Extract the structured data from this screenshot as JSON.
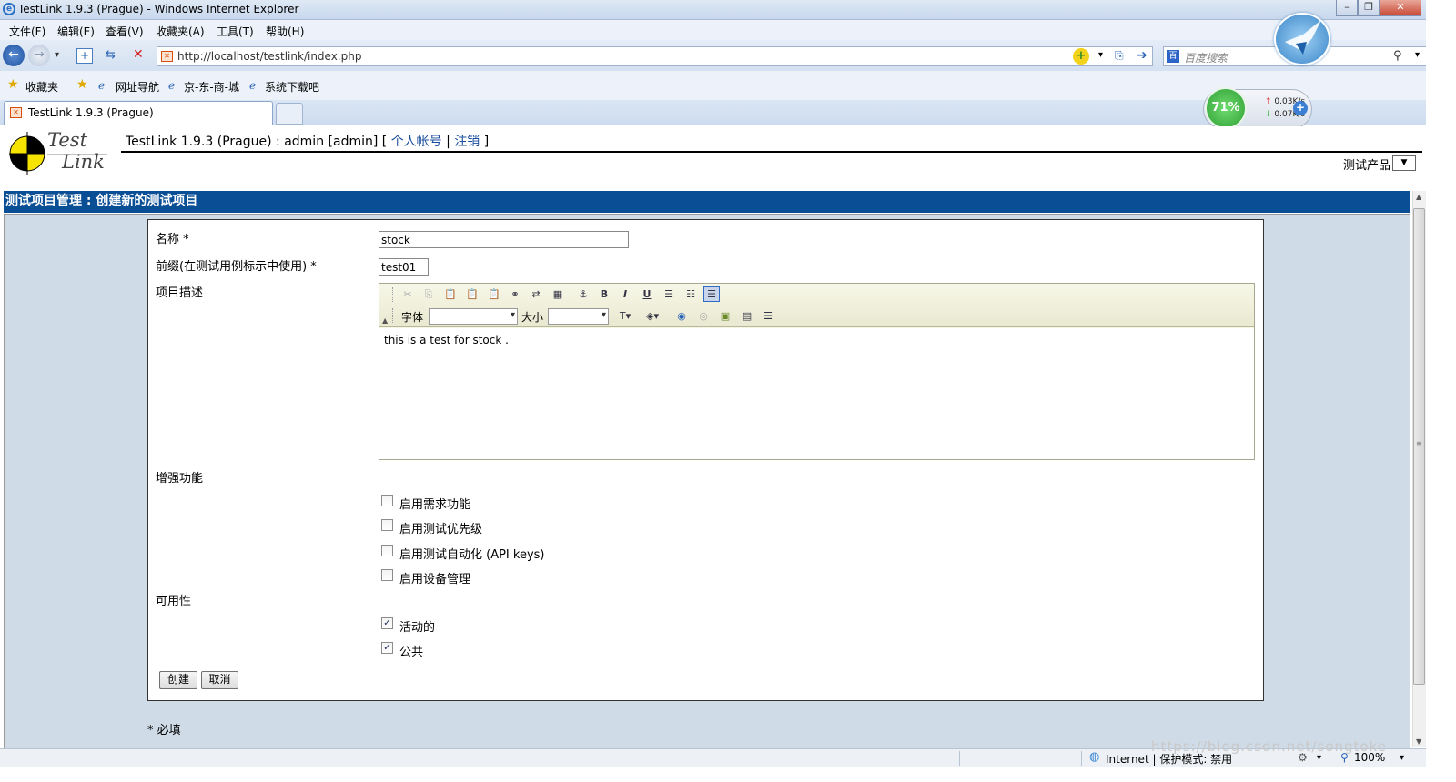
{
  "window": {
    "title": "TestLink 1.9.3 (Prague) - Windows Internet Explorer"
  },
  "menu": [
    "文件(F)",
    "编辑(E)",
    "查看(V)",
    "收藏夹(A)",
    "工具(T)",
    "帮助(H)"
  ],
  "address": {
    "url": "http://localhost/testlink/index.php",
    "search_placeholder": "百度搜索"
  },
  "favorites": {
    "label": "收藏夹",
    "items": [
      "网址导航",
      "京-东-商-城",
      "系统下载吧"
    ]
  },
  "tab": {
    "title": "TestLink 1.9.3 (Prague)"
  },
  "net_widget": {
    "percent": "71%",
    "up": "0.03K/s",
    "down": "0.07K/s"
  },
  "header": {
    "logo_top": "Test",
    "logo_bottom": "Link",
    "info": "TestLink 1.9.3 (Prague) : admin [admin] [",
    "account_link": "个人帐号",
    "separator": "|",
    "logout_link": "注销",
    "close_bracket": "]",
    "product_label": "测试产品"
  },
  "page_title": "测试项目管理 : 创建新的测试项目",
  "form": {
    "name_label": "名称 *",
    "name_value": "stock",
    "prefix_label": "前缀(在测试用例标示中使用) *",
    "prefix_value": "test01",
    "desc_label": "项目描述",
    "editor": {
      "font_label": "字体",
      "size_label": "大小",
      "content": "this is a test for stock ."
    },
    "enhanced_label": "增强功能",
    "features": [
      {
        "label": "启用需求功能",
        "checked": false
      },
      {
        "label": "启用测试优先级",
        "checked": false
      },
      {
        "label": "启用测试自动化 (API keys)",
        "checked": false
      },
      {
        "label": "启用设备管理",
        "checked": false
      }
    ],
    "availability_label": "可用性",
    "availability": [
      {
        "label": "活动的",
        "checked": true
      },
      {
        "label": "公共",
        "checked": true
      }
    ],
    "create_button": "创建",
    "cancel_button": "取消",
    "required_note": "* 必填"
  },
  "statusbar": {
    "zone": "Internet | 保护模式: 禁用",
    "zoom": "100%"
  },
  "watermark": "https://blog.csdn.net/songtoke",
  "colors": {
    "title_bar_blue": "#0a4e96",
    "work_bg": "#cfdbe7",
    "link": "#1a4e9c"
  }
}
